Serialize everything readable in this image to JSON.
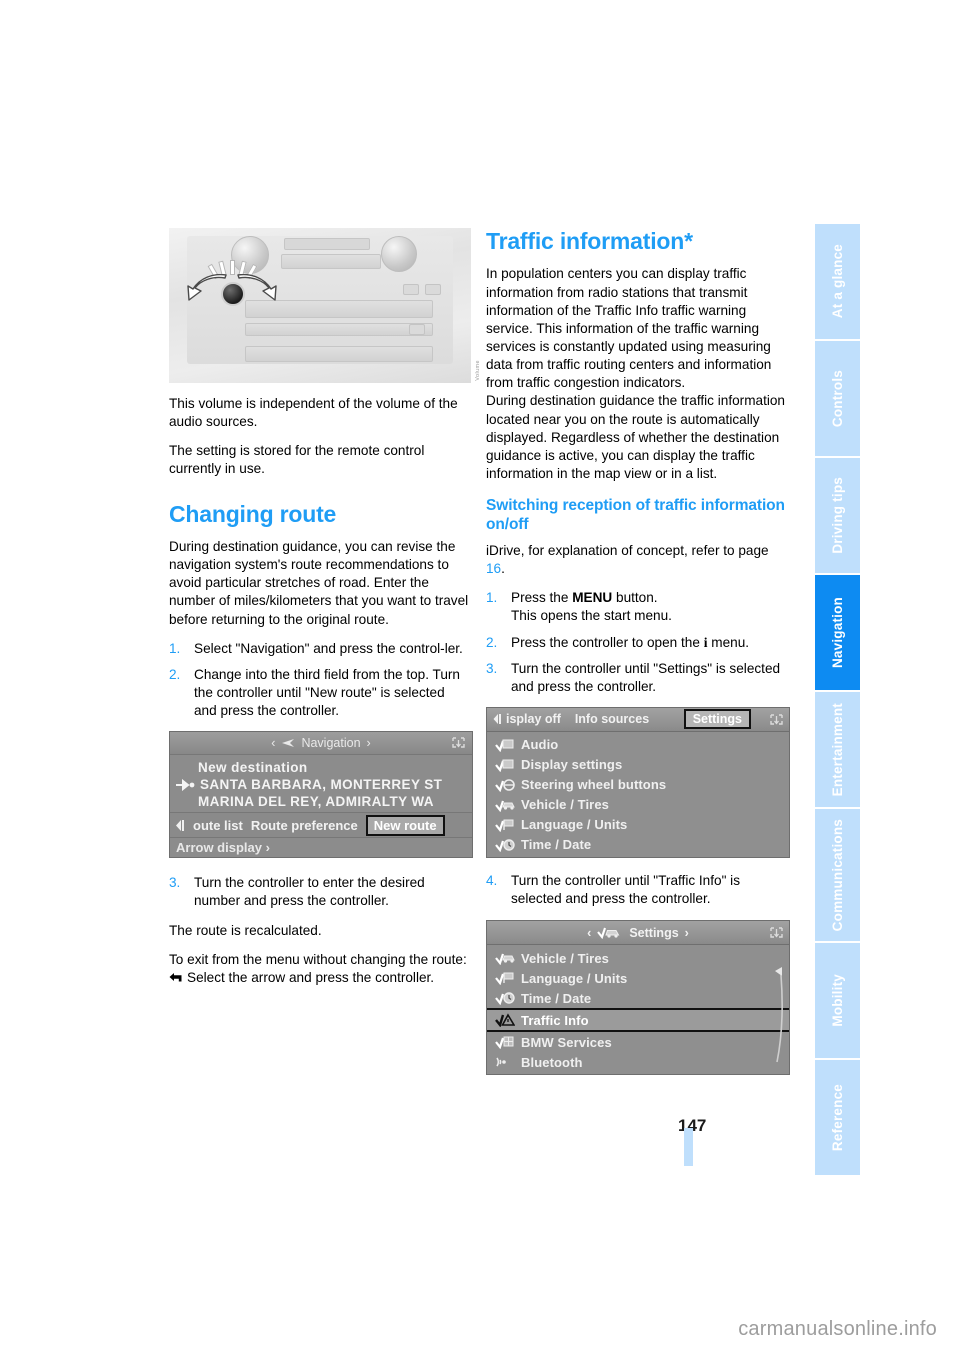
{
  "document": {
    "page_number": "147",
    "watermark": "carmanualsonline.info"
  },
  "sidebar": {
    "tabs": [
      {
        "label": "At a glance",
        "active": false
      },
      {
        "label": "Controls",
        "active": false
      },
      {
        "label": "Driving tips",
        "active": false
      },
      {
        "label": "Navigation",
        "active": true
      },
      {
        "label": "Entertainment",
        "active": false
      },
      {
        "label": "Communications",
        "active": false
      },
      {
        "label": "Mobility",
        "active": false
      },
      {
        "label": "Reference",
        "active": false
      }
    ]
  },
  "left_column": {
    "figure_console": {
      "caption_code": "Volume"
    },
    "para_volume": "This volume is independent of the volume of the audio sources.",
    "para_setting": "The setting is stored for the remote control currently in use.",
    "heading_changing_route": "Changing route",
    "para_intro": "During destination guidance, you can revise the navigation system's route recommendations to avoid particular stretches of road. Enter the number of miles/kilometers that you want to travel before returning to the original route.",
    "steps": [
      {
        "num": "1.",
        "text": "Select \"Navigation\" and press the control-ler."
      },
      {
        "num": "2.",
        "text": "Change into the third field from the top. Turn the controller until \"New route\" is selected and press the controller."
      }
    ],
    "nav_screen": {
      "title": "Navigation",
      "arrow_left": "‹",
      "arrow_right": "›",
      "line_new_destination": "New destination",
      "line_street_1": "SANTA BARBARA, MONTERREY ST",
      "line_street_2": "MARINA DEL REY, ADMIRALTY WA",
      "bar_items": [
        "oute list",
        "Route preference"
      ],
      "bar_selected": "New route",
      "footer": "Arrow display ›"
    },
    "step3": {
      "num": "3.",
      "text": "Turn the controller to enter the desired number and press the controller."
    },
    "para_recalculated": "The route is recalculated.",
    "para_exit": "To exit from the menu without changing the route:",
    "para_select_arrow": "Select the arrow and press the controller."
  },
  "right_column": {
    "heading_traffic": "Traffic information*",
    "para_traffic_1": "In population centers you can display traffic information from radio stations that transmit information of the Traffic Info traffic warning service. This information of the traffic warning services is constantly updated using measuring data from traffic routing centers and information from traffic congestion indicators.",
    "para_traffic_2": "During destination guidance the traffic information located near you on the route is automatically displayed. Regardless of whether the destination guidance is active, you can display the traffic information in the map view or in a list.",
    "heading_switching": "Switching reception of traffic information on/off",
    "para_idrive_pre": "iDrive, for explanation of concept, refer to page ",
    "para_idrive_ref": "16",
    "para_idrive_post": ".",
    "steps": [
      {
        "num": "1.",
        "text_a": "Press the ",
        "kbd": "MENU",
        "text_b": " button.",
        "line2": "This opens the start menu."
      },
      {
        "num": "2.",
        "text_a": "Press the controller to open the ",
        "kbd": "i",
        "text_b": " menu."
      },
      {
        "num": "3.",
        "text_a": "Turn the controller until \"Settings\" is selected and press the controller."
      }
    ],
    "settings_screen_1": {
      "tab_left": "isplay off",
      "tab_mid": "Info sources",
      "tab_selected": "Settings",
      "items": [
        "Audio",
        "Display settings",
        "Steering wheel buttons",
        "Vehicle / Tires",
        "Language / Units",
        "Time / Date"
      ]
    },
    "step4": {
      "num": "4.",
      "text": "Turn the controller until \"Traffic Info\" is selected and press the controller."
    },
    "settings_screen_2": {
      "title": "Settings",
      "arrow_left": "‹",
      "arrow_right": "›",
      "items": [
        {
          "label": "Vehicle / Tires",
          "selected": false
        },
        {
          "label": "Language / Units",
          "selected": false
        },
        {
          "label": "Time / Date",
          "selected": false
        },
        {
          "label": "Traffic Info",
          "selected": true
        },
        {
          "label": "BMW Services",
          "selected": false
        },
        {
          "label": "Bluetooth",
          "selected": false
        }
      ]
    }
  },
  "colors": {
    "accent_blue": "#1f9df5",
    "tab_inactive": "#bfdffc",
    "tab_active": "#0d8bf2",
    "screen_gray": "#8c8c8c"
  }
}
